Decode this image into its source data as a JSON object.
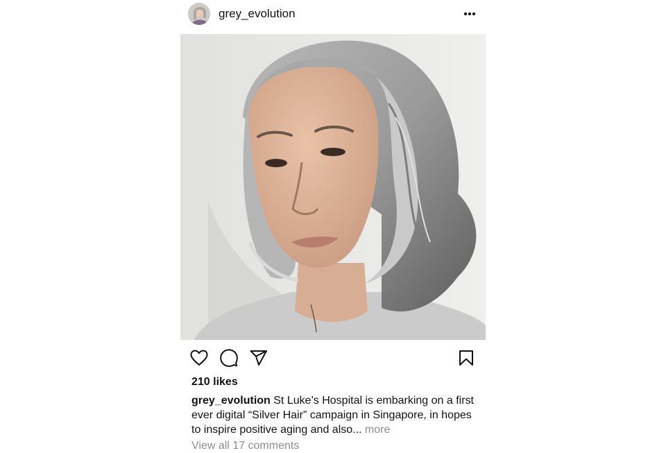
{
  "post": {
    "username": "grey_evolution",
    "more_icon": "more-horizontal-icon",
    "photo_description_icon": "portrait-photo",
    "actions": {
      "like_icon": "heart-icon",
      "comment_icon": "comment-icon",
      "share_icon": "send-icon",
      "save_icon": "bookmark-icon"
    },
    "likes_label": "210 likes",
    "caption": {
      "username": "grey_evolution",
      "text": " St Luke’s Hospital is embarking on a first ever digital “Silver Hair” campaign in Singapore, in hopes to inspire positive aging and also...",
      "more_label": " more"
    },
    "comments_label": "View all 17 comments"
  }
}
